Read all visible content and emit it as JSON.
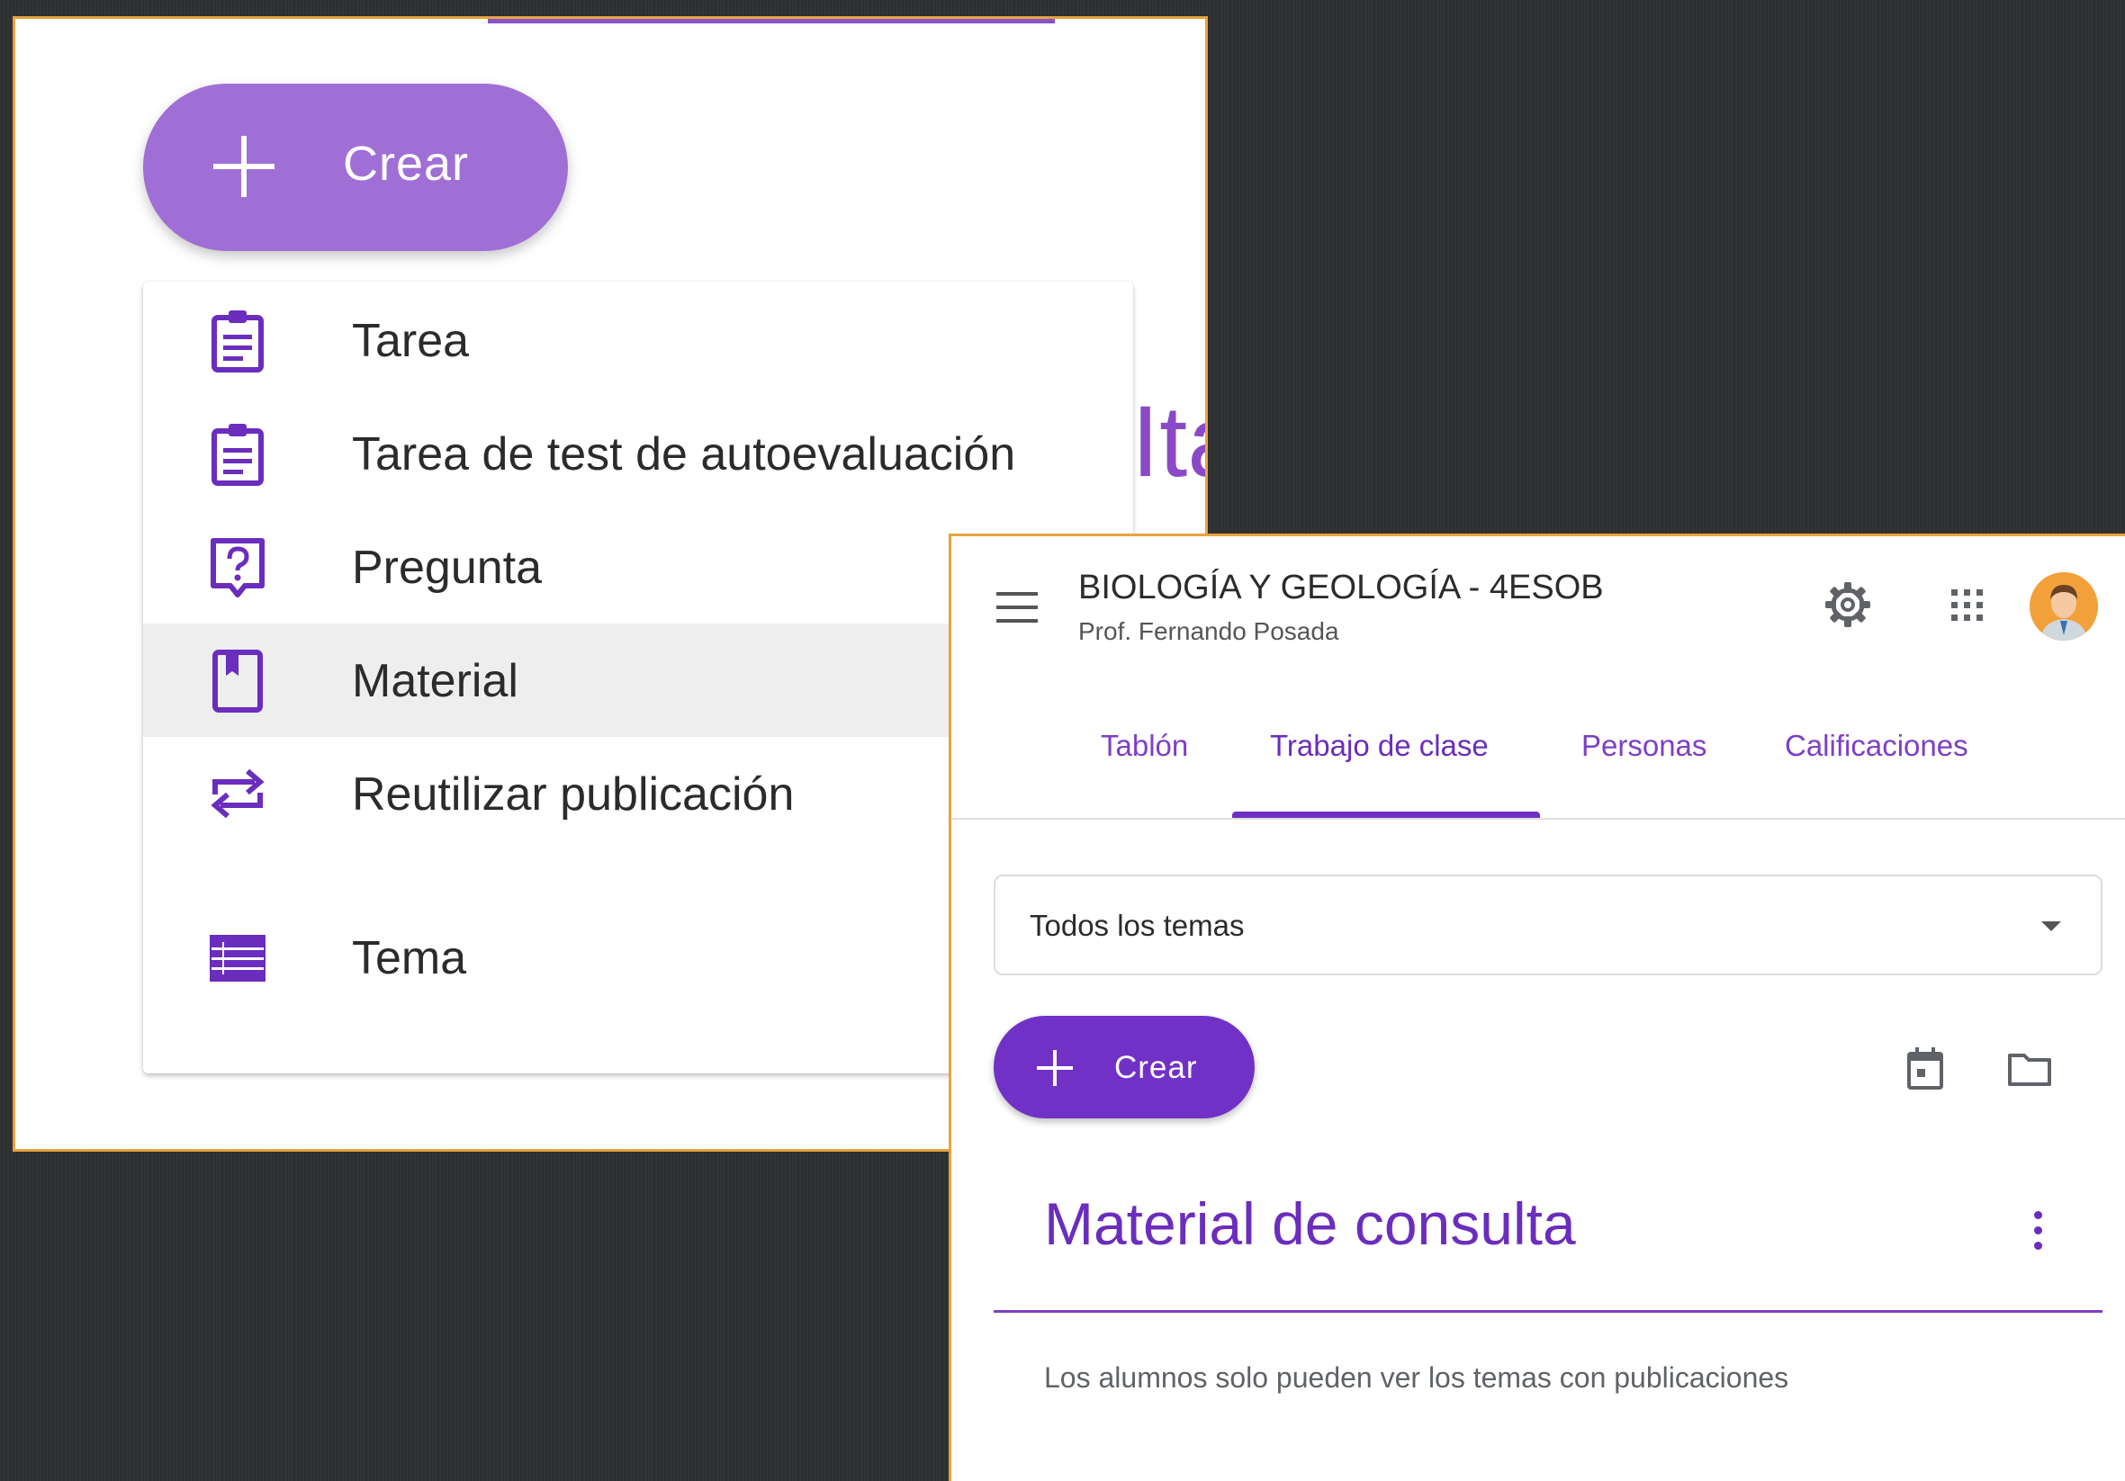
{
  "zoomed_menu": {
    "create_button_label": "Crear",
    "behind_text": "Ita",
    "items": [
      {
        "icon": "assignment-icon",
        "label": "Tarea"
      },
      {
        "icon": "quiz-assignment-icon",
        "label": "Tarea de test de autoevaluación"
      },
      {
        "icon": "question-icon",
        "label": "Pregunta"
      },
      {
        "icon": "material-book-icon",
        "label": "Material",
        "highlighted": true
      },
      {
        "icon": "repost-arrows-icon",
        "label": "Reutilizar publicación"
      },
      {
        "icon": "topic-list-icon",
        "label": "Tema"
      }
    ]
  },
  "classroom": {
    "course_title": "BIOLOGÍA Y GEOLOGÍA - 4ESOB",
    "teacher": "Prof. Fernando Posada",
    "header_icons": [
      "menu-icon",
      "settings-gear-icon",
      "apps-grid-icon",
      "user-avatar"
    ],
    "tabs": [
      {
        "label": "Tablón",
        "active": false
      },
      {
        "label": "Trabajo de clase",
        "active": true
      },
      {
        "label": "Personas",
        "active": false
      },
      {
        "label": "Calificaciones",
        "active": false
      }
    ],
    "topic_filter": {
      "selected": "Todos los temas"
    },
    "create_button_label": "Crear",
    "toolbar_icons": [
      "calendar-icon",
      "folder-icon"
    ],
    "section": {
      "title": "Material de consulta",
      "note": "Los alumnos solo pueden ver los temas con publicaciones"
    }
  },
  "colors": {
    "accent_purple": "#7131c6",
    "light_purple_button": "#a06fd6",
    "icon_purple": "#6a2dbd",
    "border_orange": "#e8a33d",
    "background": "#2d2f31"
  }
}
